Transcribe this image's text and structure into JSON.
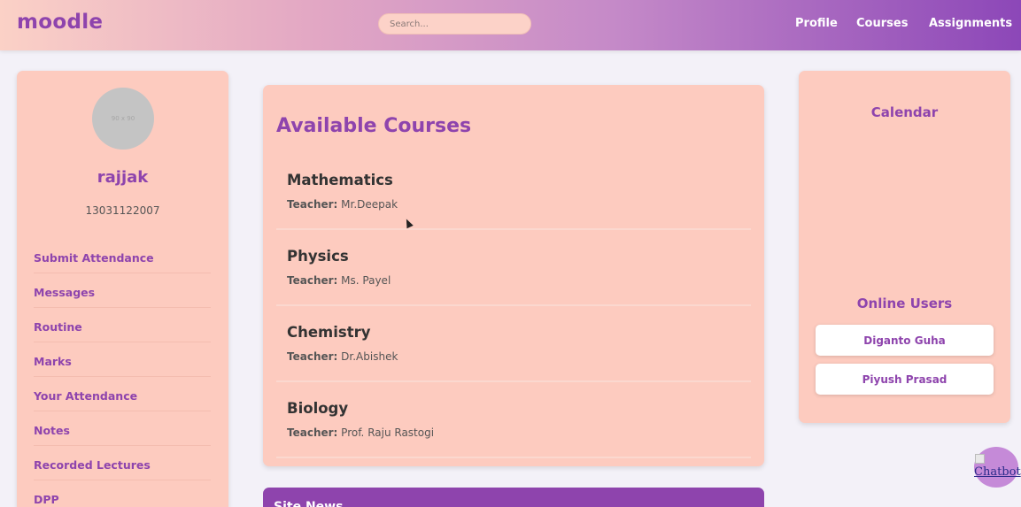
{
  "header": {
    "logo": "moodle",
    "search_placeholder": "Search...",
    "nav": [
      "Profile",
      "Courses",
      "Assignments"
    ]
  },
  "profile": {
    "avatar_placeholder": "90 x 90",
    "name": "rajjak",
    "id": "13031122007",
    "menu": [
      "Submit Attendance",
      "Messages",
      "Routine",
      "Marks",
      "Your Attendance",
      "Notes",
      "Recorded Lectures",
      "DPP"
    ]
  },
  "courses": {
    "heading": "Available Courses",
    "teacher_label": "Teacher:",
    "items": [
      {
        "title": "Mathematics",
        "teacher": "Mr.Deepak"
      },
      {
        "title": "Physics",
        "teacher": "Ms. Payel"
      },
      {
        "title": "Chemistry",
        "teacher": "Dr.Abishek"
      },
      {
        "title": "Biology",
        "teacher": "Prof. Raju Rastogi"
      }
    ]
  },
  "sidebar_right": {
    "calendar_title": "Calendar",
    "online_title": "Online Users",
    "online_users": [
      "Diganto Guha",
      "Piyush Prasad"
    ]
  },
  "news": {
    "title": "Site News"
  },
  "chatbot": {
    "alt": "Chatbot"
  },
  "colors": {
    "accent": "#8e44ad",
    "panel": "#fdcbbf",
    "background": "#f3f1f8"
  }
}
